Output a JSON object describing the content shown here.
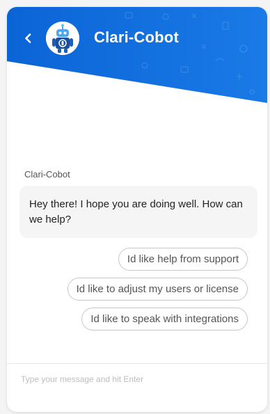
{
  "header": {
    "title": "Clari-Cobot",
    "back_icon": "chevron-left-icon",
    "avatar_icon": "robot-avatar-icon",
    "brand_color": "#0a67d8"
  },
  "conversation": {
    "sender": "Clari-Cobot",
    "message": "Hey there! I hope you are doing well. How can we help?"
  },
  "quick_replies": [
    "Id like help from support",
    "Id like to adjust my users or license",
    "Id like to speak with integrations"
  ],
  "composer": {
    "placeholder": "Type your message and hit Enter",
    "value": ""
  }
}
